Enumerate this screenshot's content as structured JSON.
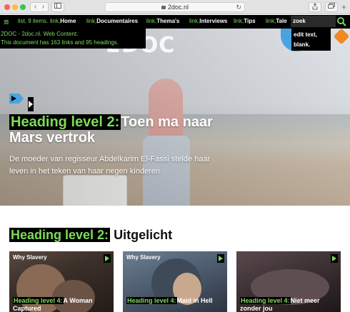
{
  "browser": {
    "url": "2doc.nl",
    "back_glyph": "‹",
    "forward_glyph": "›",
    "reload_glyph": "↻",
    "plus_glyph": "+"
  },
  "nav": {
    "list_announcement": "list, 9 items.",
    "items": [
      {
        "prefix": "link,",
        "label": "Home"
      },
      {
        "prefix": "link,",
        "label": "Documentaires"
      },
      {
        "prefix": "link,",
        "label": "Thema's"
      },
      {
        "prefix": "link,",
        "label": "Interviews"
      },
      {
        "prefix": "link,",
        "label": "Tips"
      },
      {
        "prefix": "link,",
        "label": "Tale"
      }
    ],
    "search_value": "zoek"
  },
  "overlays": {
    "page_info_line1": "2DOC - 2doc.nl. Web Content.",
    "page_info_line2": "This document has 163 links and 95 headings.",
    "search_info_line1": "edit text,",
    "search_info_line2": "blank."
  },
  "logo": {
    "text": "2DOC"
  },
  "hero": {
    "heading_label": "Heading level 2:",
    "title": "Toen ma naar Mars vertrok",
    "subtitle": "De moeder van regisseur Abdelkarim El-Fassi stelde haar leven in het teken van haar negen kinderen."
  },
  "section": {
    "heading_label": "Heading level 2:",
    "title": "Uitgelicht"
  },
  "cards": [
    {
      "tag": "Why Slavery",
      "heading_label": "Heading level 4:",
      "title": "A Woman Captured"
    },
    {
      "tag": "Why Slavery",
      "heading_label": "Heading level 4:",
      "title": "Maid in Hell"
    },
    {
      "tag": "",
      "heading_label": "Heading level 4:",
      "title": "Niet meer zonder jou"
    }
  ],
  "colors": {
    "voiceover_green": "#7ddc5a",
    "accent_blue": "#4aa3df",
    "accent_orange": "#f08a24"
  }
}
